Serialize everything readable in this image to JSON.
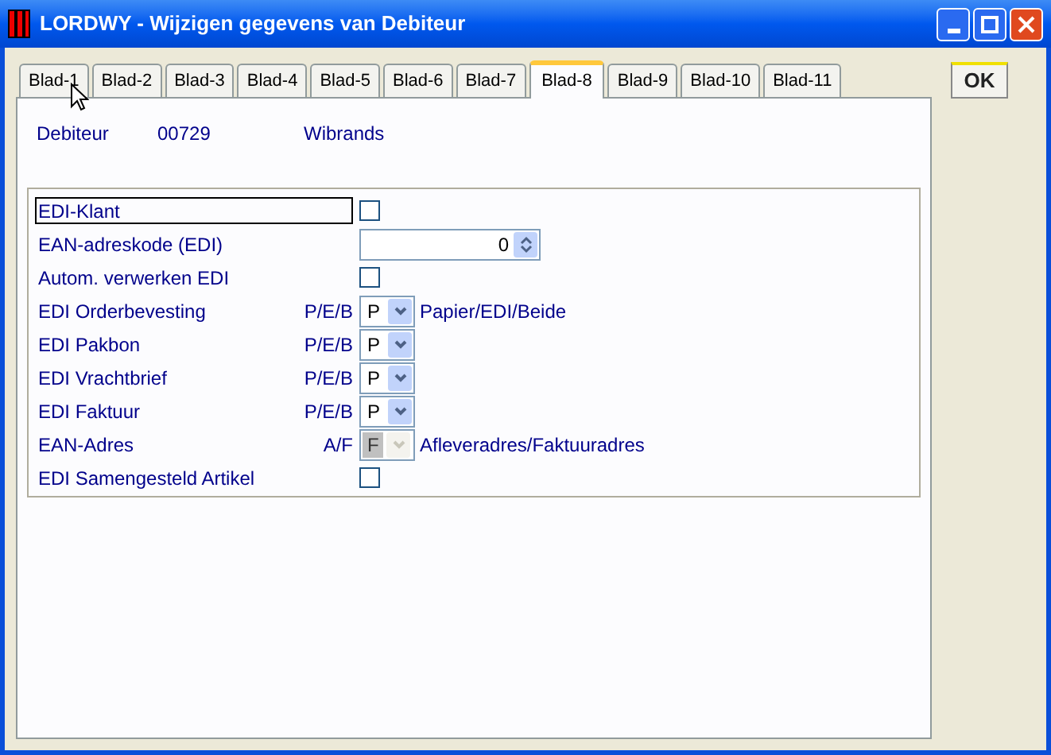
{
  "window": {
    "title": "LORDWY - Wijzigen gegevens van Debiteur"
  },
  "tabs": [
    {
      "label": "Blad-1",
      "selected": false
    },
    {
      "label": "Blad-2",
      "selected": false
    },
    {
      "label": "Blad-3",
      "selected": false
    },
    {
      "label": "Blad-4",
      "selected": false
    },
    {
      "label": "Blad-5",
      "selected": false
    },
    {
      "label": "Blad-6",
      "selected": false
    },
    {
      "label": "Blad-7",
      "selected": false
    },
    {
      "label": "Blad-8",
      "selected": true
    },
    {
      "label": "Blad-9",
      "selected": false
    },
    {
      "label": "Blad-10",
      "selected": false
    },
    {
      "label": "Blad-11",
      "selected": false
    }
  ],
  "ok_button": "OK",
  "debiteur": {
    "label": "Debiteur",
    "number": "00729",
    "name": "Wibrands"
  },
  "rows": [
    {
      "kind": "checkbox",
      "label": "EDI-Klant",
      "focused": true,
      "checked": false
    },
    {
      "kind": "spinner",
      "label": "EAN-adreskode (EDI)",
      "focused": false,
      "value": "0"
    },
    {
      "kind": "checkbox",
      "label": "Autom. verwerken EDI",
      "focused": false,
      "checked": false
    },
    {
      "kind": "select",
      "label": "EDI Orderbevesting",
      "code": "P/E/B",
      "focused": false,
      "value": "P",
      "disabled": false,
      "hint": "Papier/EDI/Beide"
    },
    {
      "kind": "select",
      "label": "EDI Pakbon",
      "code": "P/E/B",
      "focused": false,
      "value": "P",
      "disabled": false
    },
    {
      "kind": "select",
      "label": "EDI Vrachtbrief",
      "code": "P/E/B",
      "focused": false,
      "value": "P",
      "disabled": false
    },
    {
      "kind": "select",
      "label": "EDI Faktuur",
      "code": "P/E/B",
      "focused": false,
      "value": "P",
      "disabled": false
    },
    {
      "kind": "select",
      "label": "EAN-Adres",
      "code": "A/F",
      "focused": false,
      "value": "F",
      "disabled": true,
      "hint": "Afleveradres/Faktuuradres"
    },
    {
      "kind": "checkbox",
      "label": "EDI Samengesteld Artikel",
      "focused": false,
      "checked": false
    }
  ]
}
